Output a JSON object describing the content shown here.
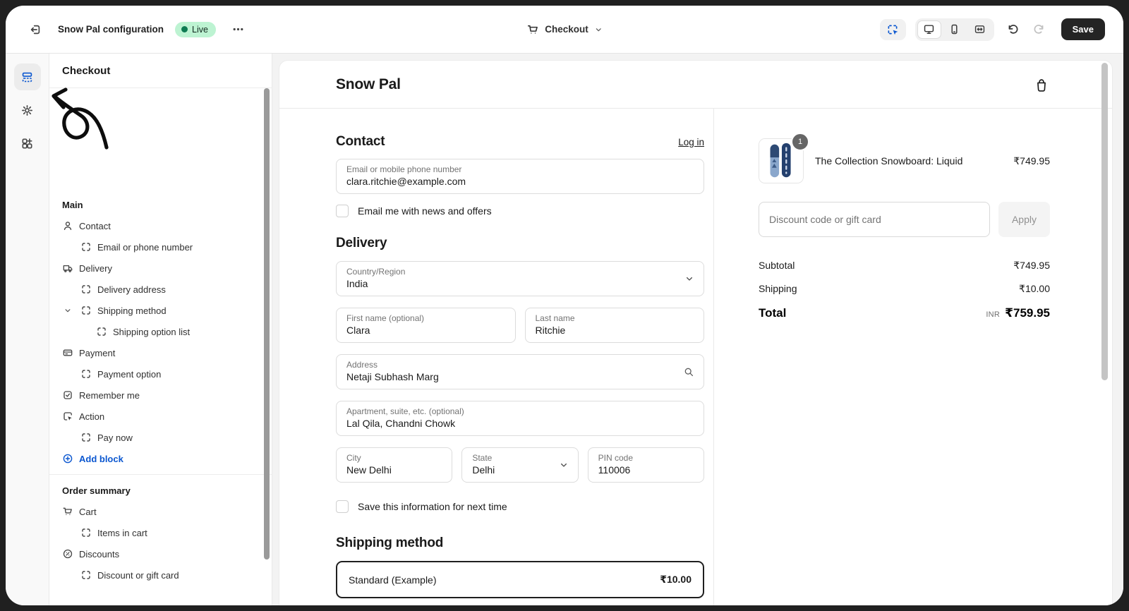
{
  "header": {
    "title": "Snow Pal configuration",
    "live_badge": "Live",
    "page_selector": "Checkout",
    "save_label": "Save"
  },
  "panel": {
    "title": "Checkout",
    "sections": [
      {
        "header": "Main",
        "rows": [
          {
            "icon": "person-icon",
            "label": "Contact"
          },
          {
            "icon": "block-icon",
            "label": "Email or phone number"
          },
          {
            "icon": "truck-icon",
            "label": "Delivery"
          },
          {
            "icon": "block-icon",
            "label": "Delivery address"
          },
          {
            "icon": "block-icon",
            "label": "Shipping method",
            "expanded": true
          },
          {
            "icon": "block-icon",
            "label": "Shipping option list"
          },
          {
            "icon": "payment-icon",
            "label": "Payment"
          },
          {
            "icon": "block-icon",
            "label": "Payment option"
          },
          {
            "icon": "checkbox-icon",
            "label": "Remember me"
          },
          {
            "icon": "cursor-icon",
            "label": "Action"
          },
          {
            "icon": "block-icon",
            "label": "Pay now"
          },
          {
            "icon": "plus-circle-icon",
            "label": "Add block"
          }
        ]
      },
      {
        "header": "Order summary",
        "rows": [
          {
            "icon": "cart-icon",
            "label": "Cart"
          },
          {
            "icon": "block-icon",
            "label": "Items in cart"
          },
          {
            "icon": "discount-icon",
            "label": "Discounts"
          },
          {
            "icon": "block-icon",
            "label": "Discount or gift card"
          }
        ]
      }
    ]
  },
  "preview": {
    "shop_name": "Snow Pal",
    "contact": {
      "heading": "Contact",
      "login_link": "Log in",
      "email_label": "Email or mobile phone number",
      "email_value": "clara.ritchie@example.com",
      "news_checkbox_label": "Email me with news and offers"
    },
    "delivery": {
      "heading": "Delivery",
      "country_label": "Country/Region",
      "country_value": "India",
      "first_name_label": "First name (optional)",
      "first_name_value": "Clara",
      "last_name_label": "Last name",
      "last_name_value": "Ritchie",
      "address_label": "Address",
      "address_value": "Netaji Subhash Marg",
      "apartment_label": "Apartment, suite, etc. (optional)",
      "apartment_value": "Lal Qila, Chandni Chowk",
      "city_label": "City",
      "city_value": "New Delhi",
      "state_label": "State",
      "state_value": "Delhi",
      "pin_label": "PIN code",
      "pin_value": "110006",
      "save_checkbox_label": "Save this information for next time"
    },
    "shipping": {
      "heading": "Shipping method",
      "option_name": "Standard (Example)",
      "option_price": "₹10.00"
    },
    "summary": {
      "item_qty": "1",
      "item_name": "The Collection Snowboard: Liquid",
      "item_price": "₹749.95",
      "discount_placeholder": "Discount code or gift card",
      "apply_label": "Apply",
      "subtotal_label": "Subtotal",
      "subtotal_value": "₹749.95",
      "shipping_label": "Shipping",
      "shipping_value": "₹10.00",
      "total_label": "Total",
      "currency": "INR",
      "total_value": "₹759.95"
    }
  },
  "colors": {
    "accent_blue": "#0b57d0",
    "live_badge_bg": "#bdf3d2",
    "live_dot": "#0e7b52",
    "save_button_bg": "#242424",
    "selected_border": "#1f1f1f"
  }
}
